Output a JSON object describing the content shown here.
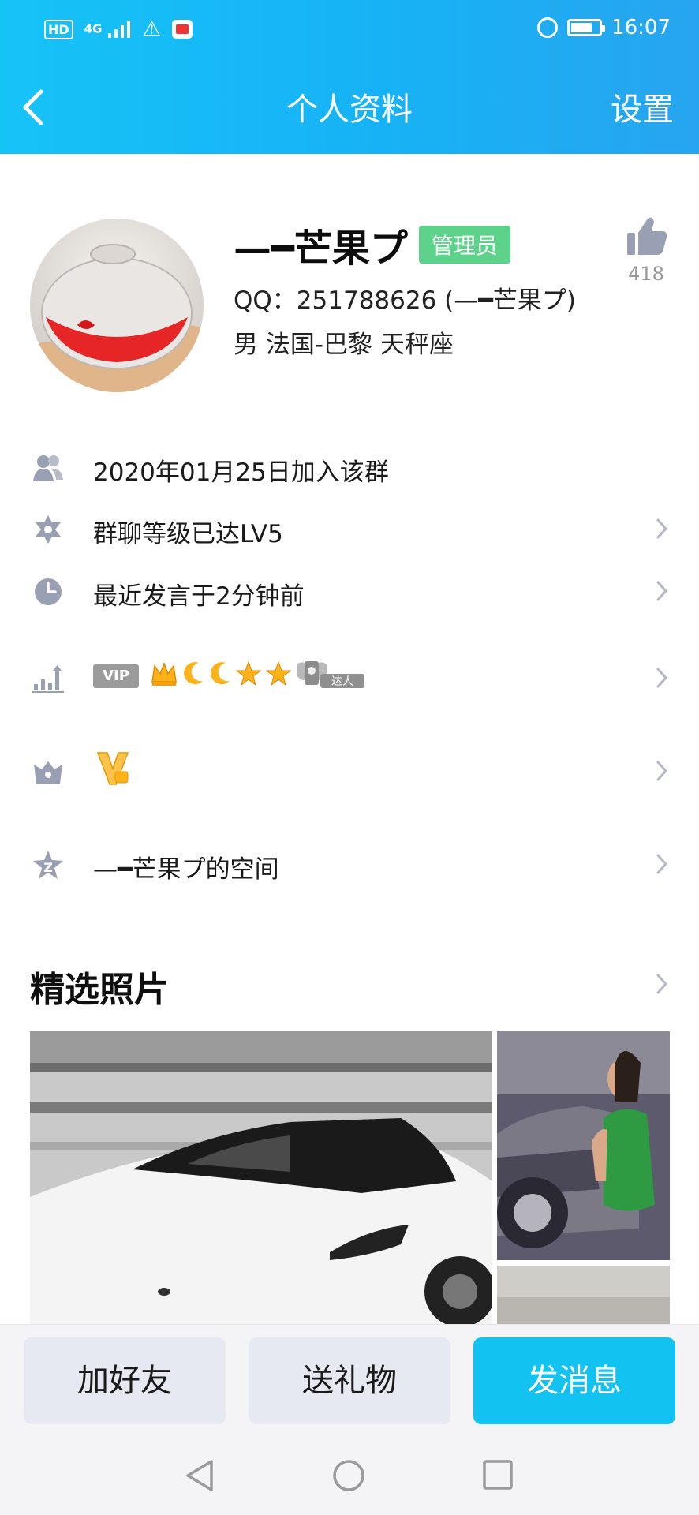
{
  "status_bar": {
    "left": {
      "hd": "HD",
      "network": "4G"
    },
    "time": "16:07"
  },
  "nav": {
    "title": "个人资料",
    "settings_label": "设置"
  },
  "profile": {
    "nickname": "—━芒果プ",
    "admin_badge": "管理员",
    "qq_line": "QQ：251788626 (—━芒果プ)",
    "info_line": "男  法国-巴黎  天秤座",
    "like_count": "418"
  },
  "rows": {
    "join_date": "2020年01月25日加入该群",
    "group_level": "群聊等级已达LV5",
    "last_speak": "最近发言于2分钟前",
    "vip_label": "VIP",
    "expert_label": "达人",
    "space": "—━芒果プ的空间"
  },
  "photos": {
    "section_title": "精选照片"
  },
  "actions": {
    "add_friend": "加好友",
    "send_gift": "送礼物",
    "send_message": "发消息"
  },
  "colors": {
    "header_start": "#16c3f7",
    "header_end": "#27a5ee",
    "accent": "#12c2f0",
    "admin_badge": "#5dd28a",
    "icon_gray": "#9aa0b4"
  }
}
